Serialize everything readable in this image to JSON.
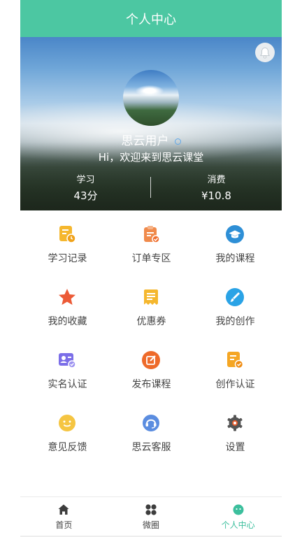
{
  "header": {
    "title": "个人中心"
  },
  "profile": {
    "username": "思云用户",
    "greeting": "Hi，欢迎来到思云课堂",
    "stats": [
      {
        "label": "学习",
        "value": "43分"
      },
      {
        "label": "消费",
        "value": "¥10.8"
      }
    ]
  },
  "menu": {
    "items": [
      {
        "label": "学习记录",
        "icon": "study-record-icon",
        "color": "#f5b72e"
      },
      {
        "label": "订单专区",
        "icon": "order-icon",
        "color": "#f08a4b"
      },
      {
        "label": "我的课程",
        "icon": "course-icon",
        "color": "#2e8fd6"
      },
      {
        "label": "我的收藏",
        "icon": "star-icon",
        "color": "#ec5a36"
      },
      {
        "label": "优惠券",
        "icon": "coupon-icon",
        "color": "#f5b72e"
      },
      {
        "label": "我的创作",
        "icon": "brush-icon",
        "color": "#2aa3e6"
      },
      {
        "label": "实名认证",
        "icon": "id-card-icon",
        "color": "#7b6ee8"
      },
      {
        "label": "发布课程",
        "icon": "edit-icon",
        "color": "#ee6a2a"
      },
      {
        "label": "创作认证",
        "icon": "certify-icon",
        "color": "#f5a623"
      },
      {
        "label": "意见反馈",
        "icon": "smile-icon",
        "color": "#f5c542"
      },
      {
        "label": "思云客服",
        "icon": "service-icon",
        "color": "#5b8de0"
      },
      {
        "label": "设置",
        "icon": "gear-icon",
        "color": "#555555"
      }
    ]
  },
  "tabbar": {
    "items": [
      {
        "label": "首页",
        "icon": "home-icon"
      },
      {
        "label": "微圈",
        "icon": "circle-icon"
      },
      {
        "label": "个人中心",
        "icon": "profile-icon",
        "active": true
      }
    ],
    "active_color": "#3cbf9d"
  }
}
